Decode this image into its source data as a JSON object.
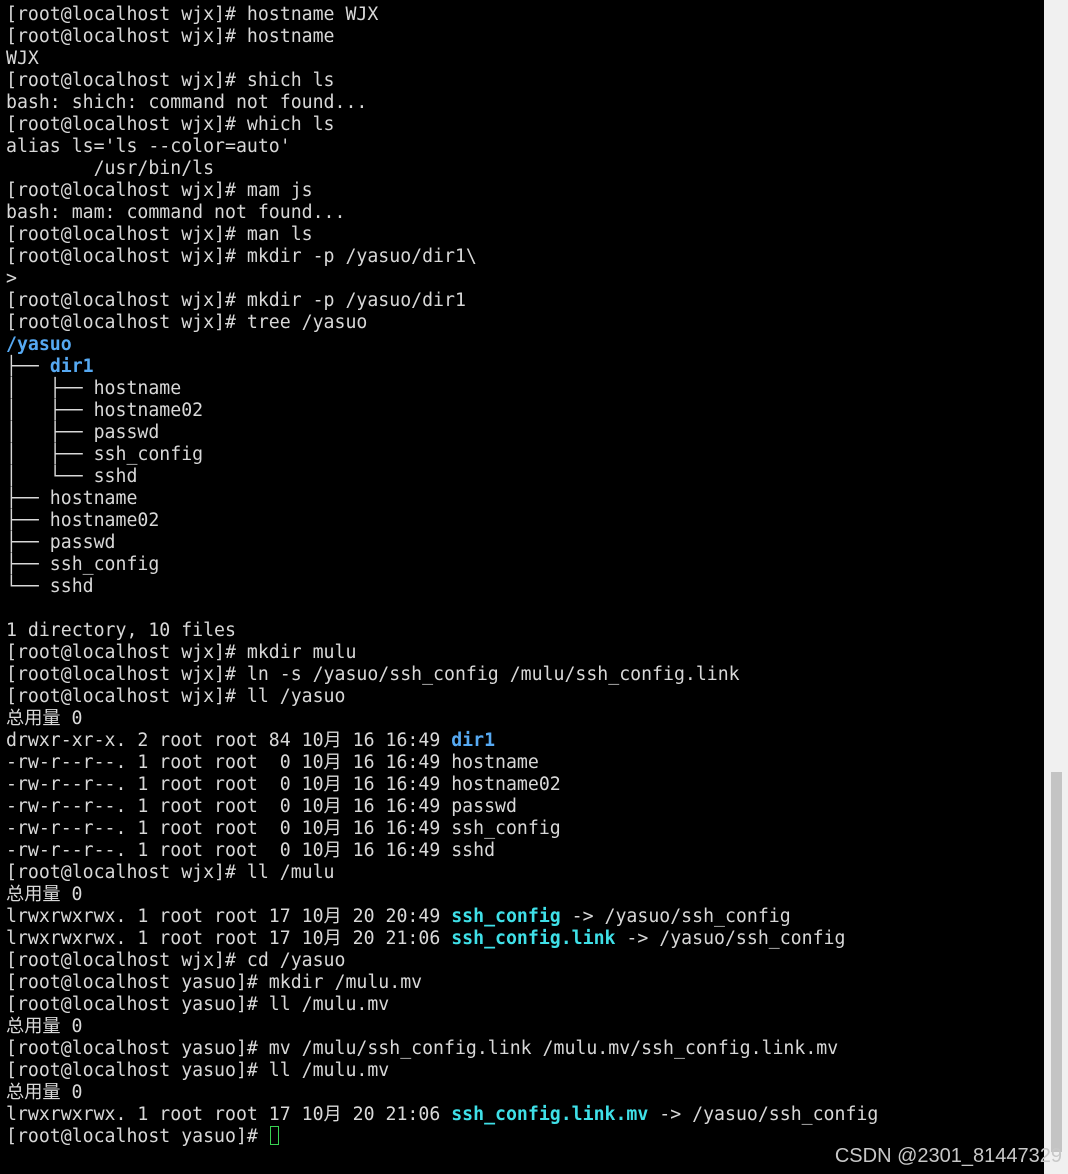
{
  "terminal": {
    "lines": [
      {
        "segments": [
          {
            "text": "[root@localhost wjx]# hostname WJX"
          }
        ]
      },
      {
        "segments": [
          {
            "text": "[root@localhost wjx]# hostname"
          }
        ]
      },
      {
        "segments": [
          {
            "text": "WJX"
          }
        ]
      },
      {
        "segments": [
          {
            "text": "[root@localhost wjx]# shich ls"
          }
        ]
      },
      {
        "segments": [
          {
            "text": "bash: shich: command not found..."
          }
        ]
      },
      {
        "segments": [
          {
            "text": "[root@localhost wjx]# which ls"
          }
        ]
      },
      {
        "segments": [
          {
            "text": "alias ls='ls --color=auto'"
          }
        ]
      },
      {
        "segments": [
          {
            "text": "        /usr/bin/ls"
          }
        ]
      },
      {
        "segments": [
          {
            "text": "[root@localhost wjx]# mam js"
          }
        ]
      },
      {
        "segments": [
          {
            "text": "bash: mam: command not found..."
          }
        ]
      },
      {
        "segments": [
          {
            "text": "[root@localhost wjx]# man ls"
          }
        ]
      },
      {
        "segments": [
          {
            "text": "[root@localhost wjx]# mkdir -p /yasuo/dir1\\"
          }
        ]
      },
      {
        "segments": [
          {
            "text": ">"
          }
        ]
      },
      {
        "segments": [
          {
            "text": "[root@localhost wjx]# mkdir -p /yasuo/dir1"
          }
        ]
      },
      {
        "segments": [
          {
            "text": "[root@localhost wjx]# tree /yasuo"
          }
        ]
      },
      {
        "segments": [
          {
            "text": "/yasuo",
            "color": "blue"
          }
        ]
      },
      {
        "segments": [
          {
            "text": "├── "
          },
          {
            "text": "dir1",
            "color": "blue"
          }
        ]
      },
      {
        "segments": [
          {
            "text": "│   ├── hostname"
          }
        ]
      },
      {
        "segments": [
          {
            "text": "│   ├── hostname02"
          }
        ]
      },
      {
        "segments": [
          {
            "text": "│   ├── passwd"
          }
        ]
      },
      {
        "segments": [
          {
            "text": "│   ├── ssh_config"
          }
        ]
      },
      {
        "segments": [
          {
            "text": "│   └── sshd"
          }
        ]
      },
      {
        "segments": [
          {
            "text": "├── hostname"
          }
        ]
      },
      {
        "segments": [
          {
            "text": "├── hostname02"
          }
        ]
      },
      {
        "segments": [
          {
            "text": "├── passwd"
          }
        ]
      },
      {
        "segments": [
          {
            "text": "├── ssh_config"
          }
        ]
      },
      {
        "segments": [
          {
            "text": "└── sshd"
          }
        ]
      },
      {
        "segments": [
          {
            "text": ""
          }
        ]
      },
      {
        "segments": [
          {
            "text": "1 directory, 10 files"
          }
        ]
      },
      {
        "segments": [
          {
            "text": "[root@localhost wjx]# mkdir mulu"
          }
        ]
      },
      {
        "segments": [
          {
            "text": "[root@localhost wjx]# ln -s /yasuo/ssh_config /mulu/ssh_config.link"
          }
        ]
      },
      {
        "segments": [
          {
            "text": "[root@localhost wjx]# ll /yasuo"
          }
        ]
      },
      {
        "segments": [
          {
            "text": "总用量 0"
          }
        ]
      },
      {
        "segments": [
          {
            "text": "drwxr-xr-x. 2 root root 84 10月 16 16:49 "
          },
          {
            "text": "dir1",
            "color": "blue"
          }
        ]
      },
      {
        "segments": [
          {
            "text": "-rw-r--r--. 1 root root  0 10月 16 16:49 hostname"
          }
        ]
      },
      {
        "segments": [
          {
            "text": "-rw-r--r--. 1 root root  0 10月 16 16:49 hostname02"
          }
        ]
      },
      {
        "segments": [
          {
            "text": "-rw-r--r--. 1 root root  0 10月 16 16:49 passwd"
          }
        ]
      },
      {
        "segments": [
          {
            "text": "-rw-r--r--. 1 root root  0 10月 16 16:49 ssh_config"
          }
        ]
      },
      {
        "segments": [
          {
            "text": "-rw-r--r--. 1 root root  0 10月 16 16:49 sshd"
          }
        ]
      },
      {
        "segments": [
          {
            "text": "[root@localhost wjx]# ll /mulu"
          }
        ]
      },
      {
        "segments": [
          {
            "text": "总用量 0"
          }
        ]
      },
      {
        "segments": [
          {
            "text": "lrwxrwxrwx. 1 root root 17 10月 20 20:49 "
          },
          {
            "text": "ssh_config",
            "color": "cyan"
          },
          {
            "text": " -> /yasuo/ssh_config"
          }
        ]
      },
      {
        "segments": [
          {
            "text": "lrwxrwxrwx. 1 root root 17 10月 20 21:06 "
          },
          {
            "text": "ssh_config.link",
            "color": "cyan"
          },
          {
            "text": " -> /yasuo/ssh_config"
          }
        ]
      },
      {
        "segments": [
          {
            "text": "[root@localhost wjx]# cd /yasuo"
          }
        ]
      },
      {
        "segments": [
          {
            "text": "[root@localhost yasuo]# mkdir /mulu.mv"
          }
        ]
      },
      {
        "segments": [
          {
            "text": "[root@localhost yasuo]# ll /mulu.mv"
          }
        ]
      },
      {
        "segments": [
          {
            "text": "总用量 0"
          }
        ]
      },
      {
        "segments": [
          {
            "text": "[root@localhost yasuo]# mv /mulu/ssh_config.link /mulu.mv/ssh_config.link.mv"
          }
        ]
      },
      {
        "segments": [
          {
            "text": "[root@localhost yasuo]# ll /mulu.mv"
          }
        ]
      },
      {
        "segments": [
          {
            "text": "总用量 0"
          }
        ]
      },
      {
        "segments": [
          {
            "text": "lrwxrwxrwx. 1 root root 17 10月 20 21:06 "
          },
          {
            "text": "ssh_config.link.mv",
            "color": "cyan"
          },
          {
            "text": " -> /yasuo/ssh_config"
          }
        ]
      },
      {
        "segments": [
          {
            "text": "[root@localhost yasuo]# "
          }
        ],
        "cursor": true
      }
    ]
  },
  "colors": {
    "background": "#000000",
    "text": "#d8d8d8",
    "directory": "#56a9f2",
    "symlink": "#3fe0e8",
    "cursor": "#39d353"
  },
  "watermark": {
    "text": "CSDN @2301_81447329"
  }
}
